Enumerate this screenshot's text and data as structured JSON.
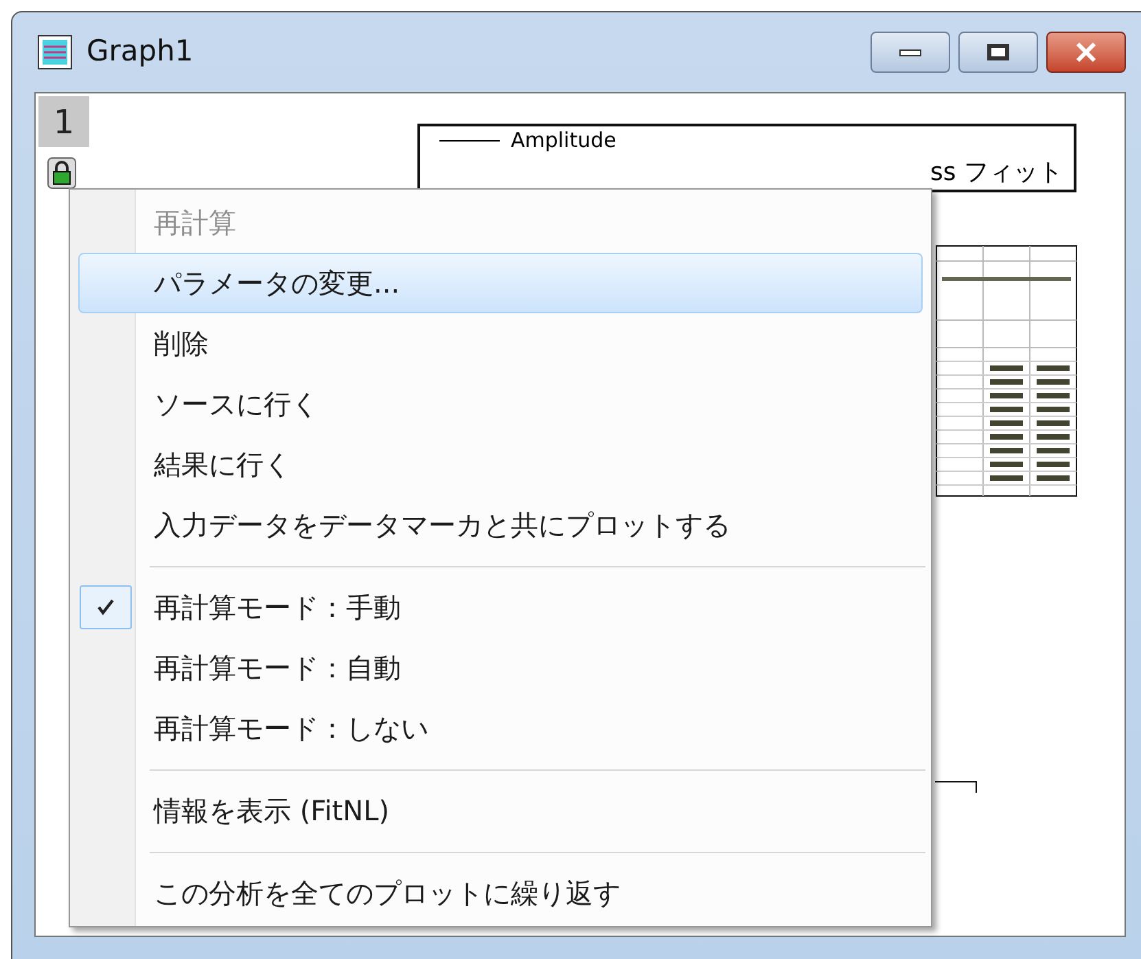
{
  "window": {
    "title": "Graph1"
  },
  "layer_tab": {
    "label": "1"
  },
  "legend": {
    "entries": [
      {
        "kind": "line",
        "label": "Amplitude"
      },
      {
        "kind": "text",
        "label": "ss フィット"
      }
    ]
  },
  "context_menu": {
    "items": [
      {
        "kind": "item",
        "label": "再計算",
        "disabled": true,
        "selected": false
      },
      {
        "kind": "item",
        "label": "パラメータの変更...",
        "disabled": false,
        "selected": true
      },
      {
        "kind": "item",
        "label": "削除",
        "disabled": false,
        "selected": false
      },
      {
        "kind": "item",
        "label": "ソースに行く",
        "disabled": false,
        "selected": false
      },
      {
        "kind": "item",
        "label": "結果に行く",
        "disabled": false,
        "selected": false
      },
      {
        "kind": "item",
        "label": "入力データをデータマーカと共にプロットする",
        "disabled": false,
        "selected": false
      },
      {
        "kind": "separator"
      },
      {
        "kind": "check",
        "label": "再計算モード：手動",
        "checked": true,
        "selected": false
      },
      {
        "kind": "check",
        "label": "再計算モード：自動",
        "checked": false,
        "selected": false
      },
      {
        "kind": "check",
        "label": "再計算モード：しない",
        "checked": false,
        "selected": false
      },
      {
        "kind": "separator"
      },
      {
        "kind": "item",
        "label": "情報を表示 (FitNL)",
        "disabled": false,
        "selected": false
      },
      {
        "kind": "separator"
      },
      {
        "kind": "item",
        "label": "この分析を全てのプロットに繰り返す",
        "disabled": false,
        "selected": false
      }
    ]
  }
}
